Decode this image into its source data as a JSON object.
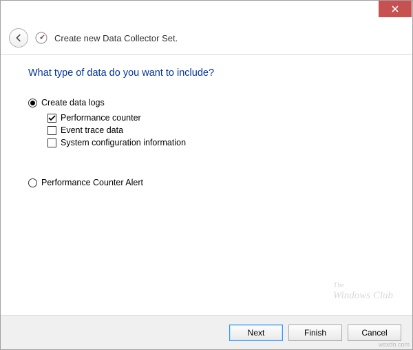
{
  "header": {
    "title": "Create new Data Collector Set."
  },
  "question": "What type of data do you want to include?",
  "options": {
    "create_logs": {
      "label": "Create data logs",
      "selected": true,
      "checks": {
        "perf_counter": {
          "label": "Performance counter",
          "checked": true
        },
        "event_trace": {
          "label": "Event trace data",
          "checked": false
        },
        "sys_config": {
          "label": "System configuration information",
          "checked": false
        }
      }
    },
    "perf_alert": {
      "label": "Performance Counter Alert",
      "selected": false
    }
  },
  "buttons": {
    "next": "Next",
    "finish": "Finish",
    "cancel": "Cancel"
  },
  "watermark": {
    "line1": "The",
    "line2": "Windows Club"
  },
  "attribution": "wsxdn.com"
}
